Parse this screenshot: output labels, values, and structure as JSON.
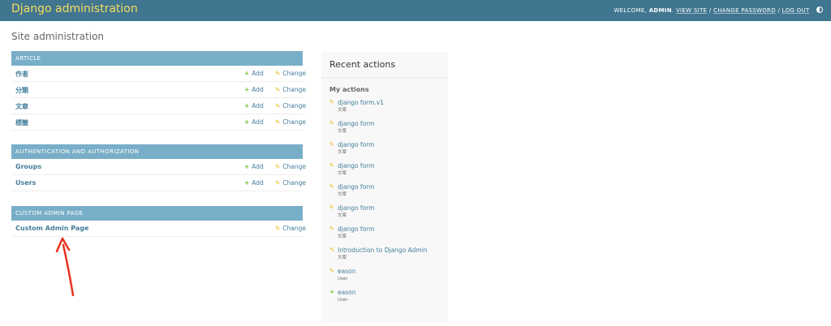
{
  "header": {
    "brand": "Django administration",
    "welcome": "WELCOME,",
    "username": "ADMIN",
    "view_site": "VIEW SITE",
    "change_password": "CHANGE PASSWORD",
    "log_out": "LOG OUT",
    "sep": "/",
    "theme_icon": "half-circle-icon"
  },
  "page_title": "Site administration",
  "modules": [
    {
      "caption": "ARTICLE",
      "rows": [
        {
          "name": "作者",
          "add": "Add",
          "change": "Change"
        },
        {
          "name": "分類",
          "add": "Add",
          "change": "Change"
        },
        {
          "name": "文章",
          "add": "Add",
          "change": "Change"
        },
        {
          "name": "標籤",
          "add": "Add",
          "change": "Change"
        }
      ]
    },
    {
      "caption": "AUTHENTICATION AND AUTHORIZATION",
      "rows": [
        {
          "name": "Groups",
          "add": "Add",
          "change": "Change"
        },
        {
          "name": "Users",
          "add": "Add",
          "change": "Change"
        }
      ]
    },
    {
      "caption": "CUSTOM ADMIN PAGE",
      "rows": [
        {
          "name": "Custom Admin Page",
          "change": "Change"
        }
      ]
    }
  ],
  "recent": {
    "title": "Recent actions",
    "subtitle": "My actions",
    "items": [
      {
        "icon": "pencil-icon",
        "title": "django form.v1",
        "model": "文章"
      },
      {
        "icon": "pencil-icon",
        "title": "django form",
        "model": "文章"
      },
      {
        "icon": "pencil-icon",
        "title": "django form",
        "model": "文章"
      },
      {
        "icon": "pencil-icon",
        "title": "django form",
        "model": "文章"
      },
      {
        "icon": "pencil-icon",
        "title": "django form",
        "model": "文章"
      },
      {
        "icon": "pencil-icon",
        "title": "django form",
        "model": "文章"
      },
      {
        "icon": "pencil-icon",
        "title": "django form",
        "model": "文章"
      },
      {
        "icon": "pencil-icon",
        "title": "Introduction to Django Admin",
        "model": "文章"
      },
      {
        "icon": "pencil-icon",
        "title": "eason",
        "model": "User"
      },
      {
        "icon": "plus-icon",
        "title": "eason",
        "model": "User"
      }
    ]
  },
  "colors": {
    "header_bg": "#417690",
    "brand": "#f5dd5d",
    "module_caption_bg": "#79aec8",
    "link": "#447e9b",
    "add_icon": "#70bf2b",
    "change_icon": "#efb80b",
    "arrow": "#e8321f"
  }
}
